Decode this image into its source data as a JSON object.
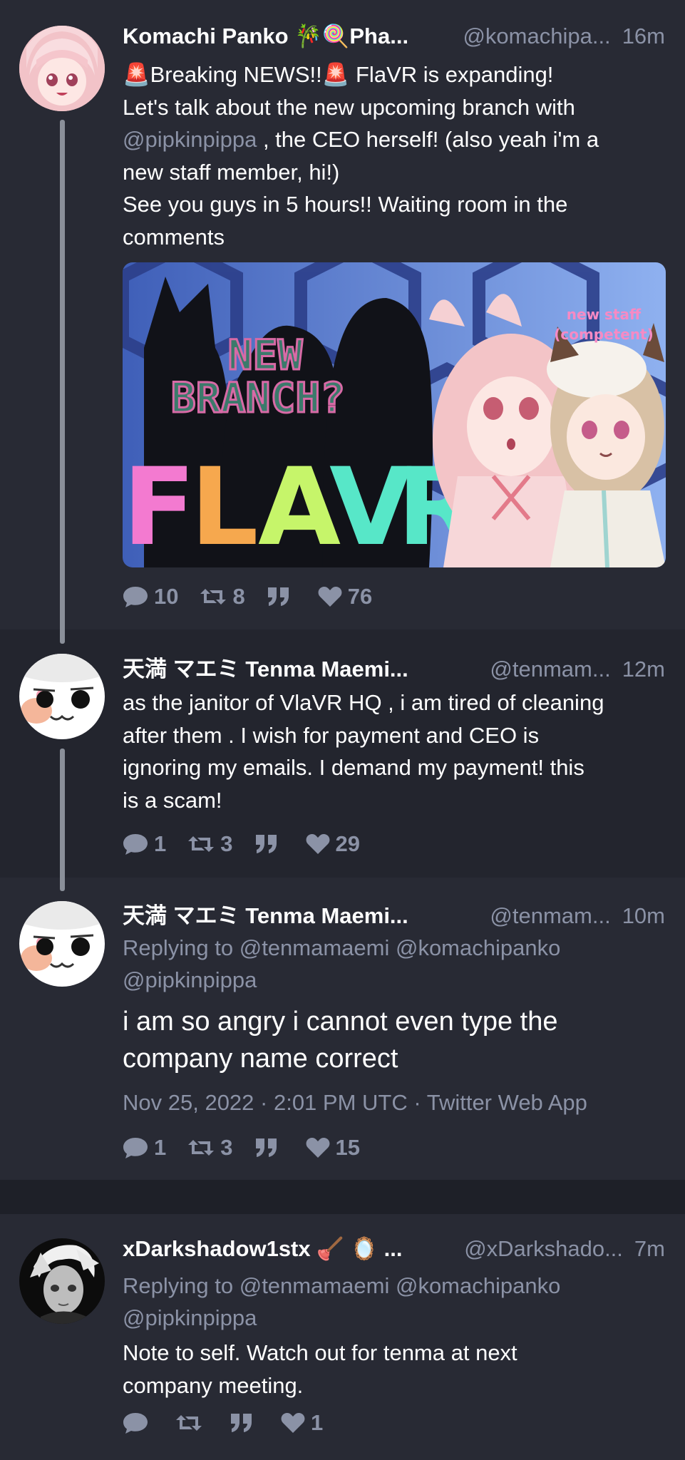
{
  "tweets": [
    {
      "fullname": "Komachi Panko 🎋🍭Pha...",
      "username": "@komachipa...",
      "time": "16m",
      "text_line1": "🚨Breaking NEWS!!🚨 FlaVR is expanding!",
      "text_line2": "Let's talk about the new upcoming branch with",
      "mention1": "@pipkinpippa",
      "text_line3_rest": " , the CEO herself! (also yeah i'm a",
      "text_line4": "new staff member, hi!)",
      "text_line5": "See you guys in 5 hours!! Waiting room in the",
      "text_line6": "comments",
      "media": {
        "headline": "NEW BRANCH?",
        "logo": "FLAVR",
        "note_line1": "new staff",
        "note_line2": "(competent)"
      },
      "stats": {
        "replies": "10",
        "retweets": "8",
        "likes": "76"
      }
    },
    {
      "fullname": "天満 マエミ Tenma Maemi...",
      "username": "@tenmam...",
      "time": "12m",
      "text_line1": "as the janitor of VlaVR HQ , i am tired of cleaning",
      "text_line2": "after them . I wish for payment and CEO is",
      "text_line3": "ignoring my emails. I demand my payment! this",
      "text_line4": "is a scam!",
      "stats": {
        "replies": "1",
        "retweets": "3",
        "likes": "29"
      }
    },
    {
      "fullname": "天満 マエミ Tenma Maemi...",
      "username": "@tenmam...",
      "time": "10m",
      "reply_prefix": "Replying to",
      "reply_mentions_line1": "@tenmamaemi @komachipanko",
      "reply_mentions_line2": "@pipkinpippa",
      "text_line1": "i am so angry i cannot even type the",
      "text_line2": "company name correct",
      "date": "Nov 25, 2022 · 2:01 PM UTC · Twitter Web App",
      "stats": {
        "replies": "1",
        "retweets": "3",
        "likes": "15"
      }
    },
    {
      "fullname": "xDarkshadow1stx 🪠 🪞 ...",
      "username": "@xDarkshado...",
      "time": "7m",
      "reply_prefix": "Replying to",
      "reply_mentions_line1": "@tenmamaemi @komachipanko",
      "reply_mentions_line2": "@pipkinpippa",
      "text_line1": "Note to self. Watch out for tenma at next",
      "text_line2": "company meeting.",
      "stats": {
        "replies": "",
        "retweets": "",
        "likes": "1"
      }
    }
  ],
  "colors": {
    "background": "#1e2028",
    "card": "#282a34",
    "card_alt": "#23252e",
    "muted": "#8b92a6"
  }
}
